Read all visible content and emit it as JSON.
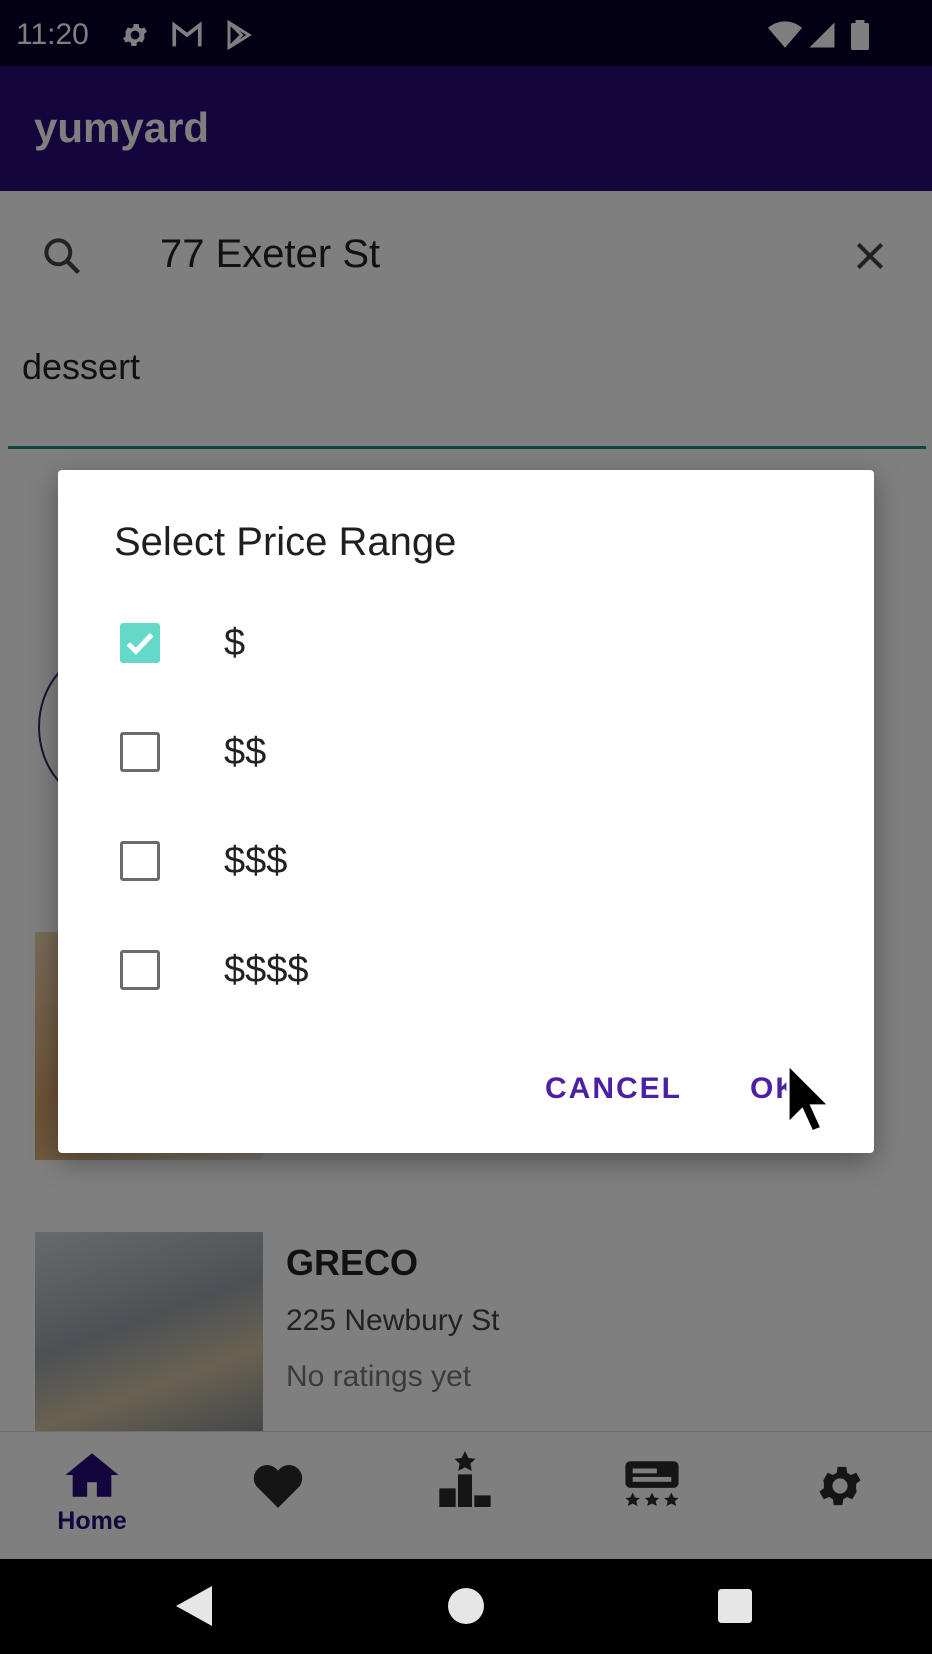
{
  "status_bar": {
    "time": "11:20"
  },
  "app": {
    "title": "yumyard"
  },
  "search": {
    "location": "77 Exeter St",
    "keyword": "dessert"
  },
  "restaurants": [
    {
      "name": "GRECO",
      "address": "225 Newbury St",
      "rating": "No ratings yet"
    }
  ],
  "bottom_nav": {
    "home_label": "Home"
  },
  "dialog": {
    "title": "Select Price Range",
    "options": [
      {
        "label": "$",
        "checked": true
      },
      {
        "label": "$$",
        "checked": false
      },
      {
        "label": "$$$",
        "checked": false
      },
      {
        "label": "$$$$",
        "checked": false
      }
    ],
    "cancel_label": "CANCEL",
    "ok_label": "OK"
  },
  "colors": {
    "status_bar": "#07012b",
    "app_bar": "#2a0a7a",
    "accent": "#4c1fa7",
    "checkbox_checked": "#64d8c9",
    "underline": "#1a8a83"
  }
}
